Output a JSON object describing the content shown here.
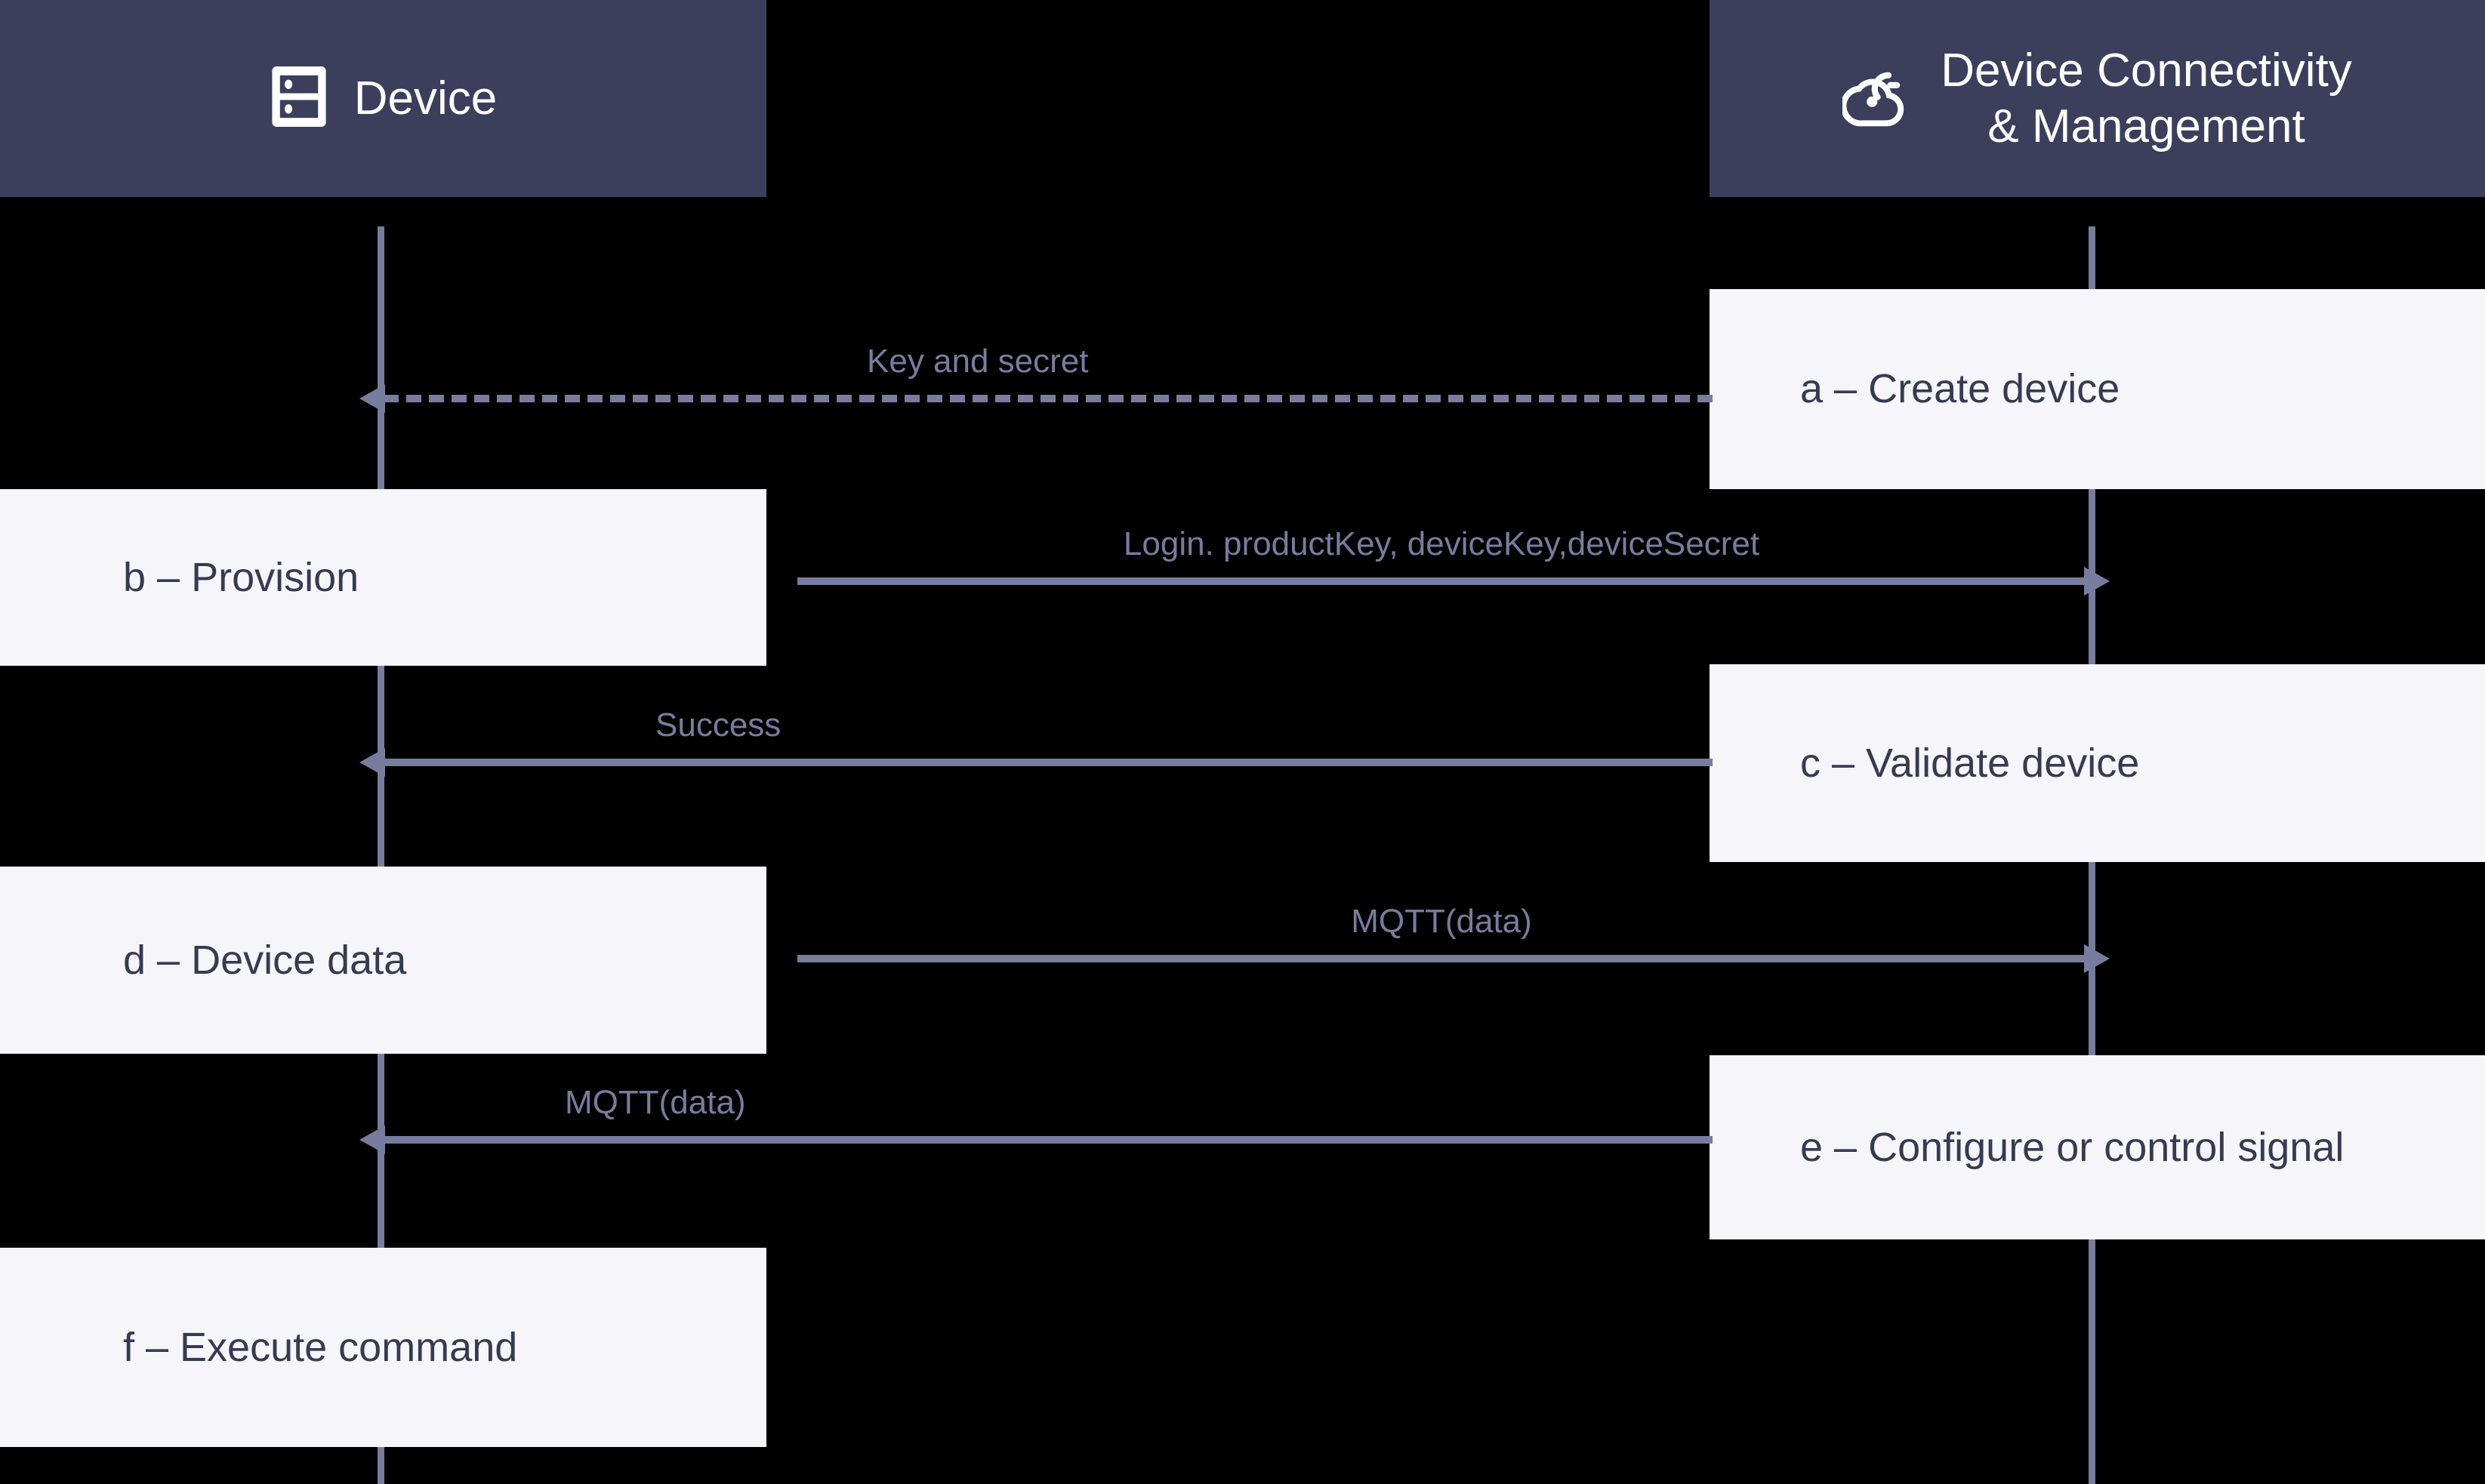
{
  "diagram": {
    "title": "Device provisioning and connectivity sequence",
    "colors": {
      "background": "#000000",
      "participant_header_fill": "#3B3F5C",
      "participant_header_text": "#FFFFFF",
      "action_box_fill": "#F5F5FA",
      "action_box_text": "#363B52",
      "lifeline": "#787C9E",
      "message_line": "#787C9E",
      "message_label_text": "#787C9E"
    }
  },
  "participants": [
    {
      "id": "device",
      "label": "Device",
      "icon": "server-rack-icon",
      "lifeline_name": "device-lifeline"
    },
    {
      "id": "cloud",
      "label": "Device Connectivity\n& Management",
      "icon": "cloud-connectivity-icon",
      "lifeline_name": "cloud-lifeline"
    }
  ],
  "action_boxes": [
    {
      "id": "a",
      "column": "right",
      "label": "a – Create device"
    },
    {
      "id": "b",
      "column": "left",
      "label": "b – Provision"
    },
    {
      "id": "c",
      "column": "right",
      "label": "c – Validate device"
    },
    {
      "id": "d",
      "column": "left",
      "label": "d – Device data"
    },
    {
      "id": "e",
      "column": "right",
      "label": "e – Configure or control signal"
    },
    {
      "id": "f",
      "column": "left",
      "label": "f – Execute command"
    }
  ],
  "messages": [
    {
      "id": "key-and-secret",
      "label": "Key and secret",
      "direction": "right-to-left",
      "style": "dashed",
      "from": "cloud",
      "to": "device"
    },
    {
      "id": "login",
      "label": "Login. productKey, deviceKey,deviceSecret",
      "direction": "left-to-right",
      "style": "solid",
      "from": "device",
      "to": "cloud"
    },
    {
      "id": "success",
      "label": "Success",
      "direction": "right-to-left",
      "style": "solid",
      "from": "cloud",
      "to": "device"
    },
    {
      "id": "mqtt-up",
      "label": "MQTT(data)",
      "direction": "left-to-right",
      "style": "solid",
      "from": "device",
      "to": "cloud"
    },
    {
      "id": "mqtt-down",
      "label": "MQTT(data)",
      "direction": "right-to-left",
      "style": "solid",
      "from": "cloud",
      "to": "device"
    }
  ]
}
